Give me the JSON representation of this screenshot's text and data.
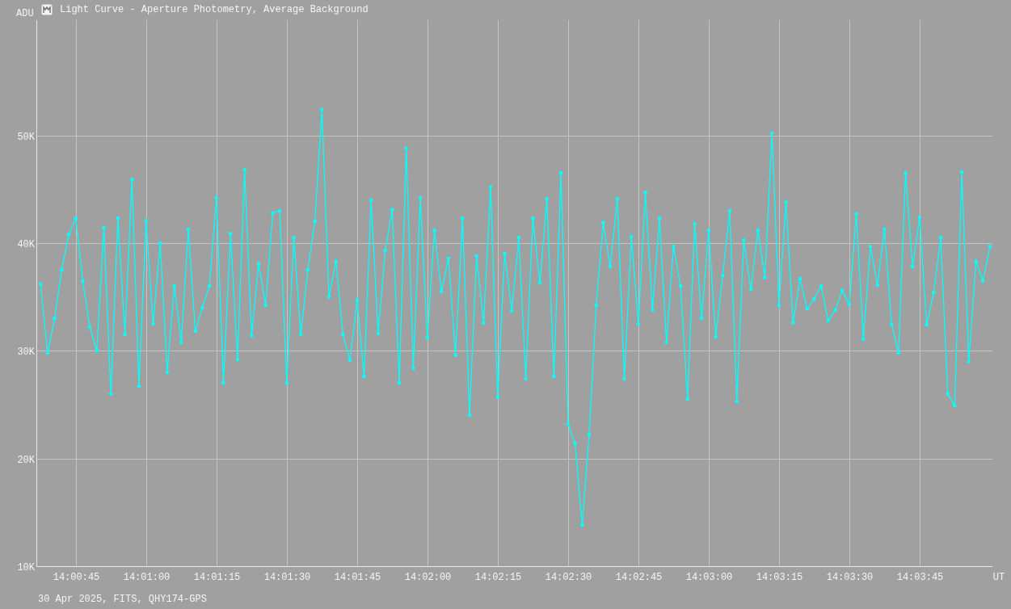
{
  "window": {
    "title": "Light Curve - Aperture Photometry, Average Background"
  },
  "chart": {
    "chart_data": {
      "type": "line",
      "grid": true,
      "ylabel": "ADU",
      "xlabel": "UT",
      "ylim": [
        10000,
        60700
      ],
      "yticks": [
        {
          "value": 10000,
          "label": "10K"
        },
        {
          "value": 20000,
          "label": "20K"
        },
        {
          "value": 30000,
          "label": "30K"
        },
        {
          "value": 40000,
          "label": "40K"
        },
        {
          "value": 50000,
          "label": "50K"
        }
      ],
      "categories": [
        null,
        null,
        null,
        null,
        null,
        "14:00:45",
        null,
        null,
        null,
        null,
        null,
        null,
        null,
        null,
        null,
        "14:01:00",
        null,
        null,
        null,
        null,
        null,
        null,
        null,
        null,
        null,
        "14:01:15",
        null,
        null,
        null,
        null,
        null,
        null,
        null,
        null,
        null,
        "14:01:30",
        null,
        null,
        null,
        null,
        null,
        null,
        null,
        null,
        null,
        "14:01:45",
        null,
        null,
        null,
        null,
        null,
        null,
        null,
        null,
        null,
        "14:02:00",
        null,
        null,
        null,
        null,
        null,
        null,
        null,
        null,
        null,
        "14:02:15",
        null,
        null,
        null,
        null,
        null,
        null,
        null,
        null,
        null,
        "14:02:30",
        null,
        null,
        null,
        null,
        null,
        null,
        null,
        null,
        null,
        "14:02:45",
        null,
        null,
        null,
        null,
        null,
        null,
        null,
        null,
        null,
        "14:03:00",
        null,
        null,
        null,
        null,
        null,
        null,
        null,
        null,
        null,
        "14:03:15",
        null,
        null,
        null,
        null,
        null,
        null,
        null,
        null,
        null,
        "14:03:30",
        null,
        null,
        null,
        null,
        null,
        null,
        null,
        null,
        null,
        "14:03:45",
        null,
        null,
        null,
        null,
        null,
        null,
        null,
        null,
        null,
        null
      ],
      "series": [
        {
          "color": "#00ffff",
          "values": [
            36200,
            29800,
            33000,
            37500,
            40800,
            42300,
            36500,
            32200,
            30000,
            41400,
            26000,
            42300,
            31500,
            45900,
            26700,
            42100,
            32500,
            40000,
            28000,
            36000,
            30800,
            41300,
            31800,
            34000,
            36000,
            44200,
            27000,
            40900,
            29200,
            46800,
            31400,
            38100,
            34200,
            42800,
            43000,
            27000,
            40500,
            31500,
            37500,
            42000,
            52400,
            35000,
            38300,
            31500,
            29100,
            34700,
            27600,
            44000,
            31600,
            39300,
            43100,
            27000,
            48800,
            28400,
            44200,
            31200,
            41200,
            35500,
            38600,
            29600,
            42300,
            24000,
            38800,
            32600,
            45200,
            25700,
            39000,
            33700,
            40500,
            27400,
            42300,
            36300,
            44100,
            27600,
            46500,
            23200,
            21400,
            13800,
            22200,
            34200,
            41900,
            37800,
            44100,
            27400,
            40600,
            32500,
            44700,
            33800,
            42300,
            30800,
            39700,
            36000,
            25500,
            41800,
            33000,
            41200,
            31300,
            37000,
            43000,
            25300,
            40300,
            35700,
            41200,
            36800,
            50200,
            34200,
            43800,
            32600,
            36700,
            33900,
            34800,
            36000,
            32800,
            33800,
            35600,
            34300,
            42700,
            31100,
            39700,
            36100,
            41300,
            32500,
            29800,
            46500,
            37800,
            42400,
            32400,
            35400,
            40500,
            26000,
            24900,
            46600,
            29000,
            38300,
            36500,
            39700
          ]
        }
      ]
    }
  },
  "footer": {
    "text": "30 Apr 2025, FITS, QHY174-GPS"
  }
}
